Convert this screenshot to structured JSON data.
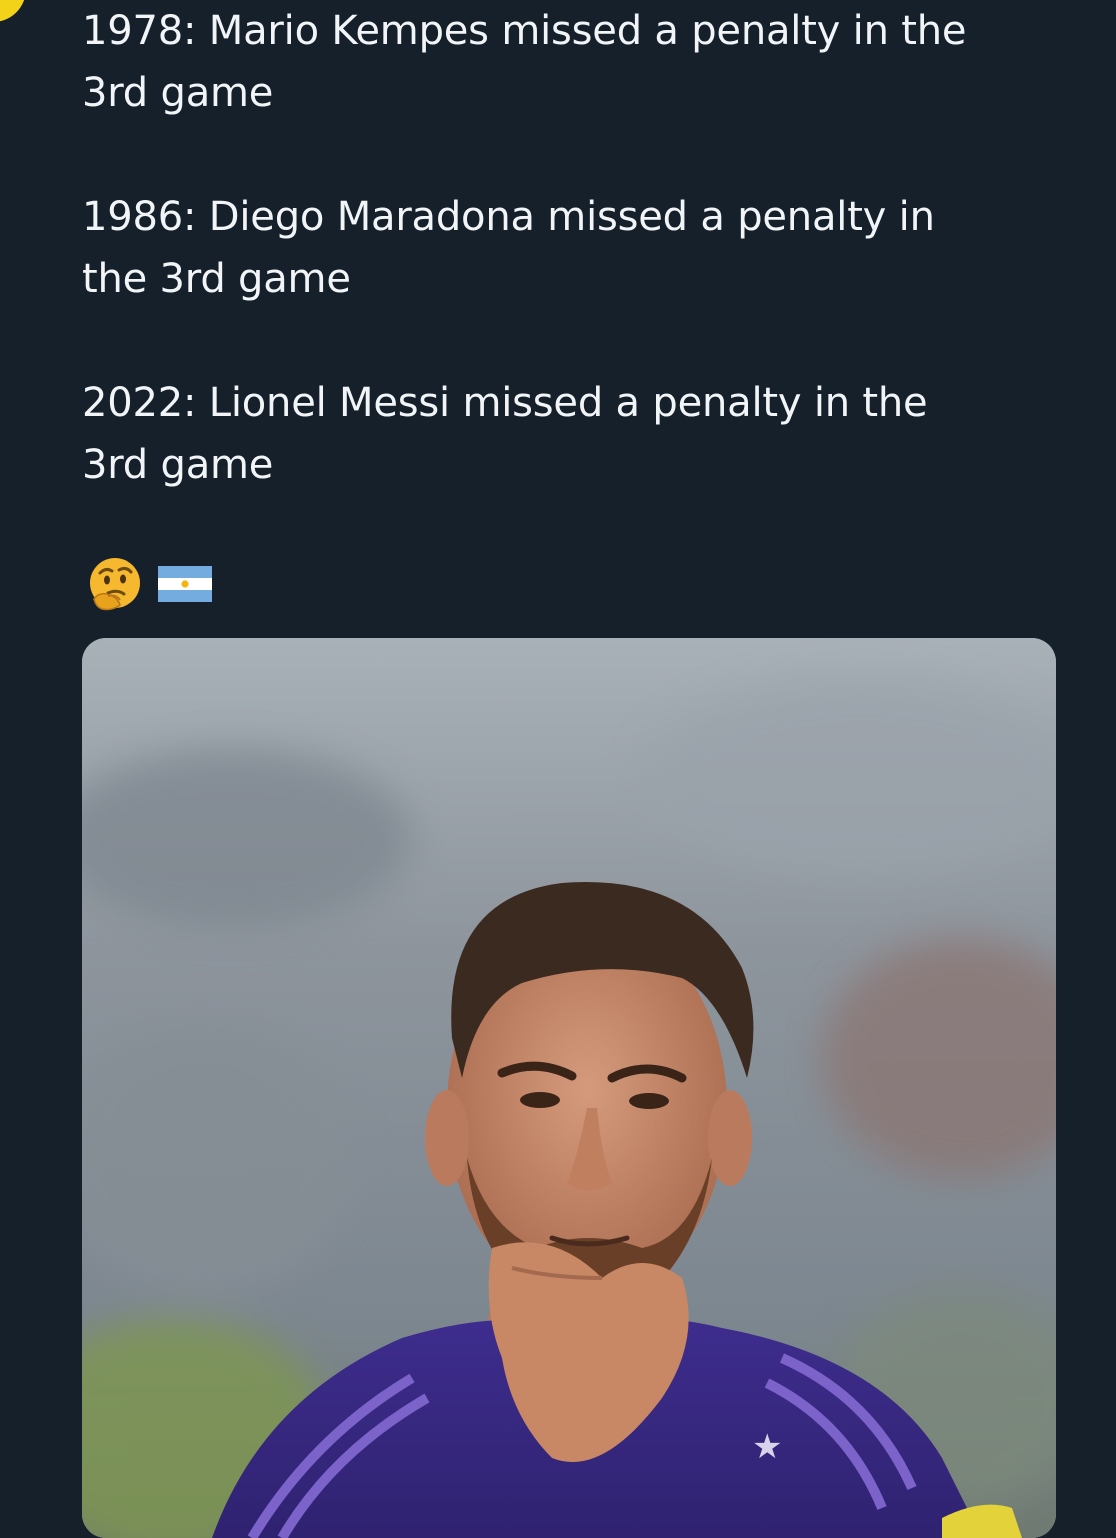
{
  "tweet": {
    "lines": [
      [
        "1978: Mario Kempes missed a penalty in the",
        "3rd game"
      ],
      [
        "1986: Diego Maradona missed a penalty in",
        "the 3rd game"
      ],
      [
        "2022: Lionel Messi missed a penalty in the",
        "3rd game"
      ]
    ],
    "emojis": [
      "thinking-face-emoji",
      "argentina-flag-emoji"
    ]
  },
  "media": {
    "icon": "photo-of-player-thinking",
    "colors": {
      "background": "#16202b",
      "text": "#f2f5f7",
      "jersey": "#3b2a86",
      "flag_blue": "#74acdf"
    }
  }
}
